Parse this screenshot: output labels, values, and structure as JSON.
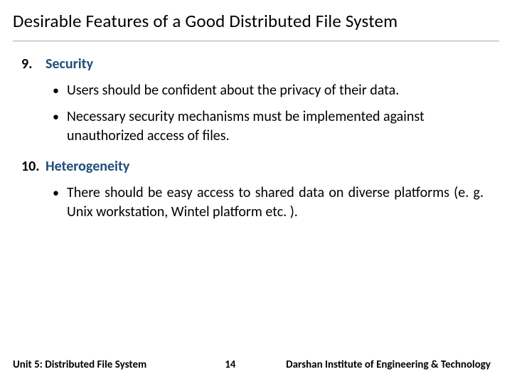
{
  "title": "Desirable Features of a Good Distributed File System",
  "sections": [
    {
      "number": "9.",
      "heading": "Security",
      "bullets": [
        "Users should be confident about the privacy of their data.",
        "Necessary security mechanisms must be implemented against unauthorized access of files."
      ],
      "justify": false
    },
    {
      "number": "10.",
      "heading": "Heterogeneity",
      "bullets": [
        "There should be easy access to shared data on diverse platforms (e. g. Unix workstation, Wintel platform etc. )."
      ],
      "justify": true
    }
  ],
  "footer": {
    "left": "Unit 5: Distributed File System",
    "center": "14",
    "right": "Darshan Institute of Engineering & Technology"
  }
}
